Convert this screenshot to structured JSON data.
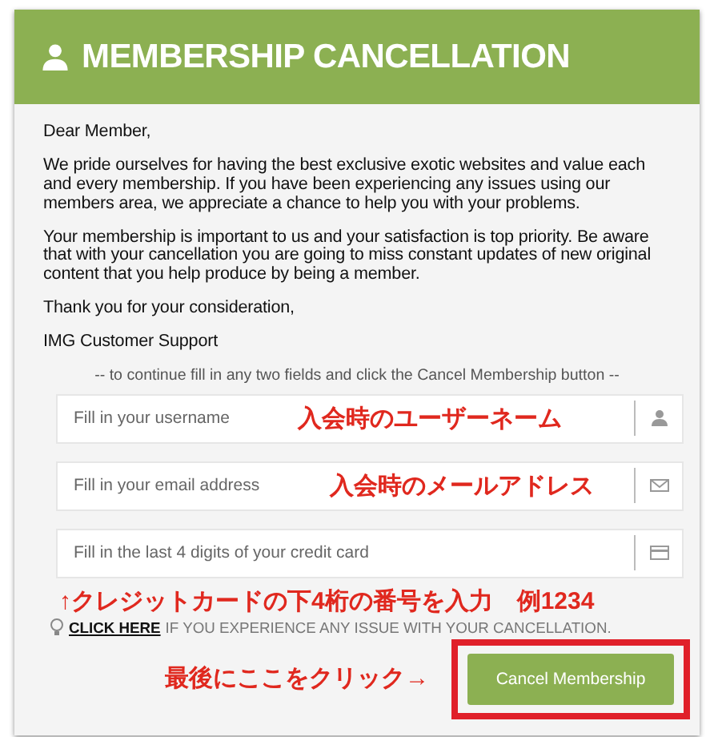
{
  "header": {
    "title": "MEMBERSHIP CANCELLATION"
  },
  "letter": [
    "Dear Member,",
    "We pride ourselves for having the best exclusive exotic websites and value each and every membership. If you have been experiencing any issues using our members area, we appreciate a chance to help you with your problems.",
    "Your membership is important to us and your satisfaction is top priority. Be aware that with your cancellation you are going to miss constant updates of new original content that you help produce by being a member.",
    "Thank you for your consideration,",
    "IMG Customer Support"
  ],
  "instruction": "-- to continue fill in any two fields and click the Cancel Membership button --",
  "fields": [
    {
      "kind": "user",
      "placeholder": "Fill in your username",
      "annotation": "入会時のユーザーネーム"
    },
    {
      "kind": "mail",
      "placeholder": "Fill in your email address",
      "annotation": "入会時のメールアドレス"
    },
    {
      "kind": "card",
      "placeholder": "Fill in the last 4 digits of your credit card"
    }
  ],
  "card_note": "↑クレジットカードの下4桁の番号を入力　例1234",
  "help": {
    "link": "CLICK HERE",
    "text": "IF YOU EXPERIENCE ANY ISSUE WITH YOUR CANCELLATION."
  },
  "button_note": "最後にここをクリック→",
  "button": "Cancel Membership"
}
